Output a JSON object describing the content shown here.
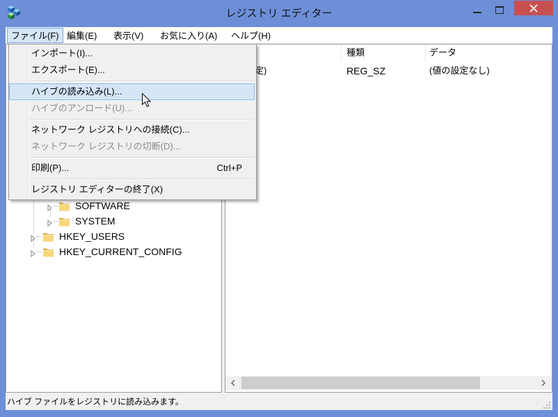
{
  "window": {
    "title": "レジストリ エディター",
    "icon": "regedit-icon",
    "frame_color": "#6d8fd8",
    "close_button_color": "#c75050",
    "caption_buttons": [
      "minimize-icon",
      "maximize-icon",
      "close-icon"
    ]
  },
  "menubar": {
    "items": [
      {
        "label": "ファイル(F)",
        "open": true
      },
      {
        "label": "編集(E)"
      },
      {
        "label": "表示(V)"
      },
      {
        "label": "お気に入り(A)"
      },
      {
        "label": "ヘルプ(H)"
      }
    ]
  },
  "file_menu": {
    "highlight_color": "#d5e5f7",
    "items": [
      {
        "label": "インポート(I)...",
        "enabled": true
      },
      {
        "label": "エクスポート(E)...",
        "enabled": true
      },
      {
        "label": "ハイブの読み込み(L)...",
        "enabled": true,
        "hovered": true
      },
      {
        "label": "ハイブのアンロード(U)...",
        "enabled": false
      },
      {
        "label": "ネットワーク レジストリへの接続(C)...",
        "enabled": true
      },
      {
        "label": "ネットワーク レジストリの切断(D)...",
        "enabled": false
      },
      {
        "label": "印刷(P)...",
        "shortcut": "Ctrl+P",
        "enabled": true
      },
      {
        "label": "レジストリ エディターの終了(X)",
        "enabled": true
      }
    ]
  },
  "tree": {
    "subkeys": [
      {
        "label": "SOFTWARE",
        "icon": "folder-icon",
        "expanded": false
      },
      {
        "label": "SYSTEM",
        "icon": "folder-icon",
        "expanded": false
      }
    ],
    "root_keys": [
      {
        "label": "HKEY_USERS",
        "icon": "folder-icon",
        "expanded": false
      },
      {
        "label": "HKEY_CURRENT_CONFIG",
        "icon": "folder-icon",
        "expanded": false
      }
    ]
  },
  "values_list": {
    "columns": [
      "種類",
      "データ"
    ],
    "rows": [
      {
        "name": "定)",
        "type": "REG_SZ",
        "data": "(値の設定なし)"
      }
    ],
    "horizontal_scrollbar": {
      "position": 0,
      "visible_fraction": 0.81
    }
  },
  "status_bar": {
    "text": "ハイブ ファイルをレジストリに読み込みます。"
  },
  "cursor": "arrow-cursor"
}
